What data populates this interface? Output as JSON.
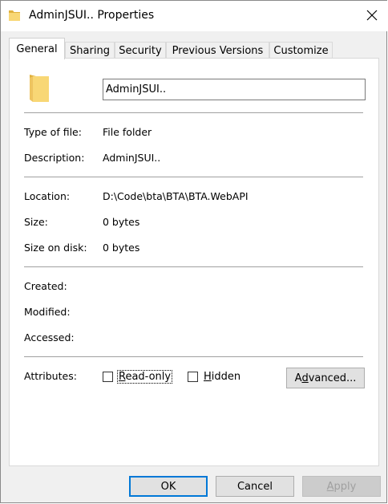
{
  "window": {
    "title": "AdminJSUI.. Properties",
    "icons": {
      "title": "folder-icon",
      "close": "close-icon"
    }
  },
  "tabs": [
    {
      "label": "General",
      "active": true
    },
    {
      "label": "Sharing",
      "active": false
    },
    {
      "label": "Security",
      "active": false
    },
    {
      "label": "Previous Versions",
      "active": false
    },
    {
      "label": "Customize",
      "active": false
    }
  ],
  "general": {
    "name_value": "AdminJSUI..",
    "type_label": "Type of file:",
    "type_value": "File folder",
    "description_label": "Description:",
    "description_value": "AdminJSUI..",
    "location_label": "Location:",
    "location_value": "D:\\Code\\bta\\BTA\\BTA.WebAPI",
    "size_label": "Size:",
    "size_value": "0 bytes",
    "size_on_disk_label": "Size on disk:",
    "size_on_disk_value": "0 bytes",
    "created_label": "Created:",
    "modified_label": "Modified:",
    "accessed_label": "Accessed:",
    "attributes_label": "Attributes:",
    "readonly": {
      "label_pre": "",
      "label_mnemonic": "R",
      "label_post": "ead-only",
      "checked": false
    },
    "hidden": {
      "label_pre": "",
      "label_mnemonic": "H",
      "label_post": "idden",
      "checked": false
    },
    "advanced": {
      "label_pre": "A",
      "label_mnemonic": "d",
      "label_post": "vanced..."
    }
  },
  "buttons": {
    "ok": "OK",
    "cancel": "Cancel",
    "apply_mnemonic": "A",
    "apply_post": "pply"
  },
  "colors": {
    "folder_yellow": "#f8d775",
    "folder_dark": "#e0b13e",
    "focus_blue": "#0078d7"
  }
}
